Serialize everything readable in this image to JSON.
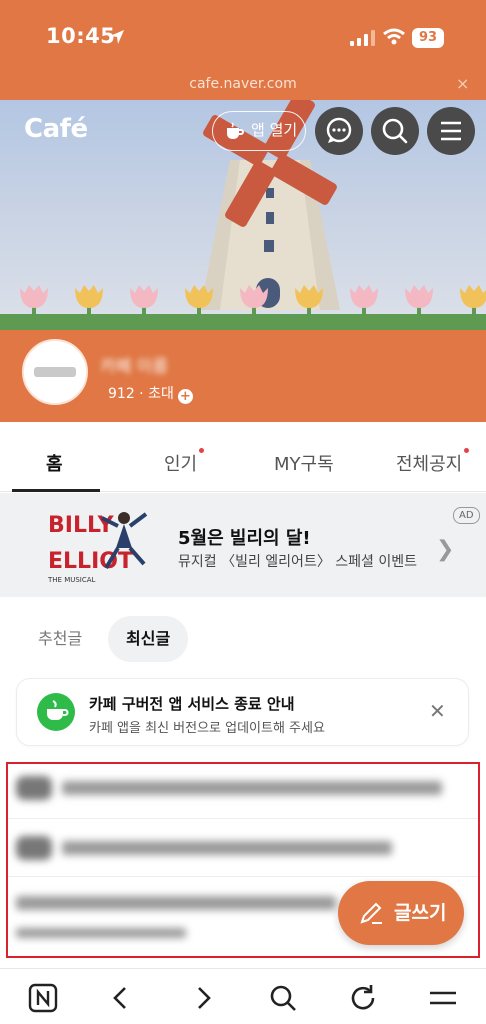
{
  "status_bar": {
    "time": "10:45",
    "battery": "93"
  },
  "browser": {
    "url": "cafe.naver.com",
    "close_glyph": "×"
  },
  "header": {
    "logo": "Café",
    "open_app_label": "앱 열기",
    "icons": [
      "chat-icon",
      "search-icon",
      "menu-icon"
    ]
  },
  "profile": {
    "name": "카페 이름",
    "meta_visible": "912 · 초대",
    "invite_glyph": "+"
  },
  "tabs": [
    {
      "label": "홈",
      "active": true,
      "dot": false
    },
    {
      "label": "인기",
      "active": false,
      "dot": true
    },
    {
      "label": "MY구독",
      "active": false,
      "dot": false
    },
    {
      "label": "전체공지",
      "active": false,
      "dot": true
    }
  ],
  "ad": {
    "poster_title": "BILLY ELLIOT",
    "poster_sub": "THE MUSICAL",
    "title": "5월은 빌리의 달!",
    "subtitle": "뮤지컬 〈빌리 엘리어트〉 스페셜 이벤트",
    "tag": "AD"
  },
  "sort": {
    "recommended": "추천글",
    "latest": "최신글",
    "selected": "latest"
  },
  "notice": {
    "title": "카페 구버전 앱 서비스 종료 안내",
    "subtitle": "카페 앱을 최신 버전으로 업데이트해 주세요"
  },
  "write_button": {
    "label": "글쓰기"
  },
  "colors": {
    "brand": "#E07744",
    "highlight_border": "#d8222e",
    "notice_icon": "#2fbb4a"
  }
}
